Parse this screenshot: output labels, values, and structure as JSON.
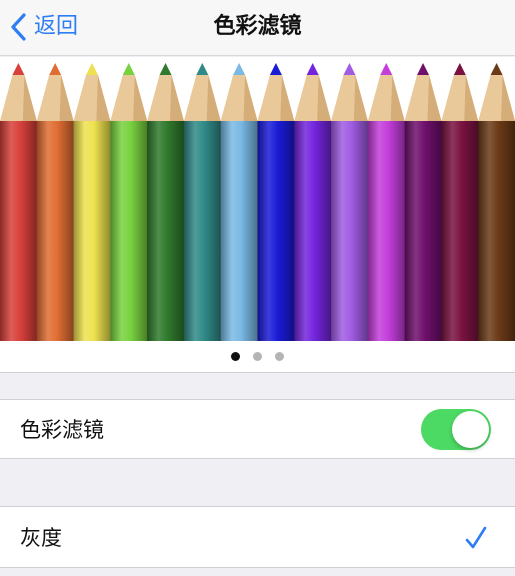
{
  "nav": {
    "back_label": "返回",
    "title": "色彩滤镜"
  },
  "pager": {
    "count": 3,
    "active_index": 0
  },
  "filter_toggle": {
    "label": "色彩滤镜",
    "on": true
  },
  "options": [
    {
      "label": "灰度",
      "selected": true
    }
  ],
  "colors": {
    "accent": "#2f7df6",
    "switch_on": "#4cd964"
  },
  "pencil_colors": [
    "#d8403b",
    "#e06d33",
    "#ede14f",
    "#78d13f",
    "#2f7a2c",
    "#2f8a87",
    "#79b9e4",
    "#1a1bd6",
    "#7324dc",
    "#a05ce3",
    "#c33edb",
    "#6e0f6c",
    "#7a1240",
    "#6b3a17"
  ]
}
